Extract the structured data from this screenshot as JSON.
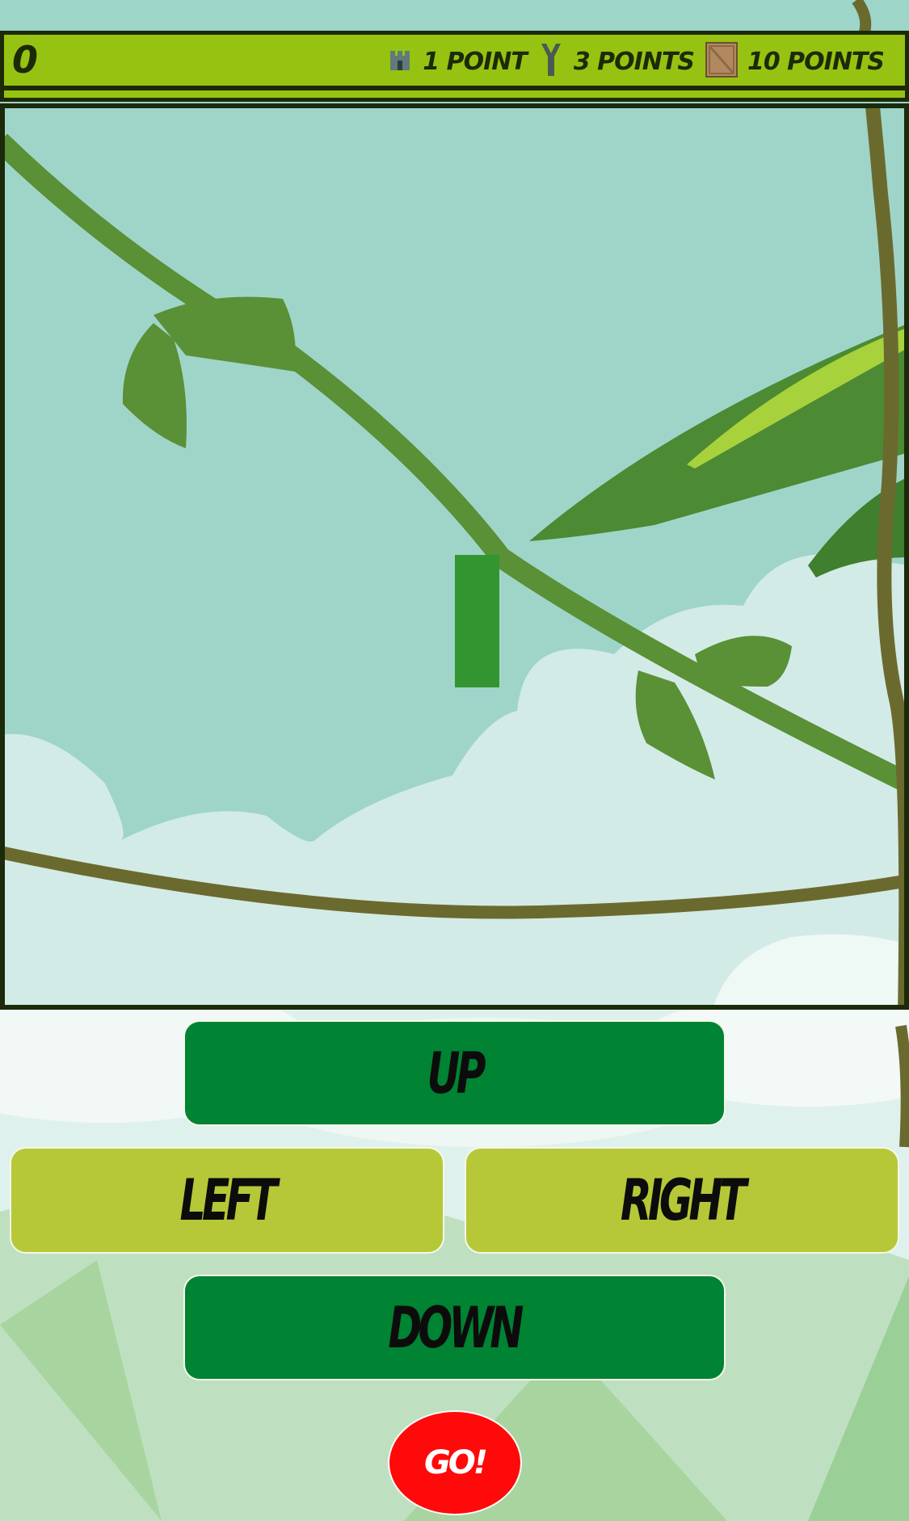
{
  "score": {
    "value": "0"
  },
  "legend": [
    {
      "icon": "tower-icon",
      "label": "1 POINT"
    },
    {
      "icon": "slingshot-icon",
      "label": "3 POINTS"
    },
    {
      "icon": "crate-icon",
      "label": "10 POINTS"
    }
  ],
  "board": {
    "food_icon": "tower-icon",
    "snake_color": "#33952f"
  },
  "controls": {
    "up": "UP",
    "left": "LEFT",
    "right": "RIGHT",
    "down": "DOWN",
    "go": "GO!"
  },
  "colors": {
    "bar": "#96c312",
    "dark_button": "#008332",
    "light_button": "#b6c837",
    "go_button": "#ff0a0a"
  }
}
